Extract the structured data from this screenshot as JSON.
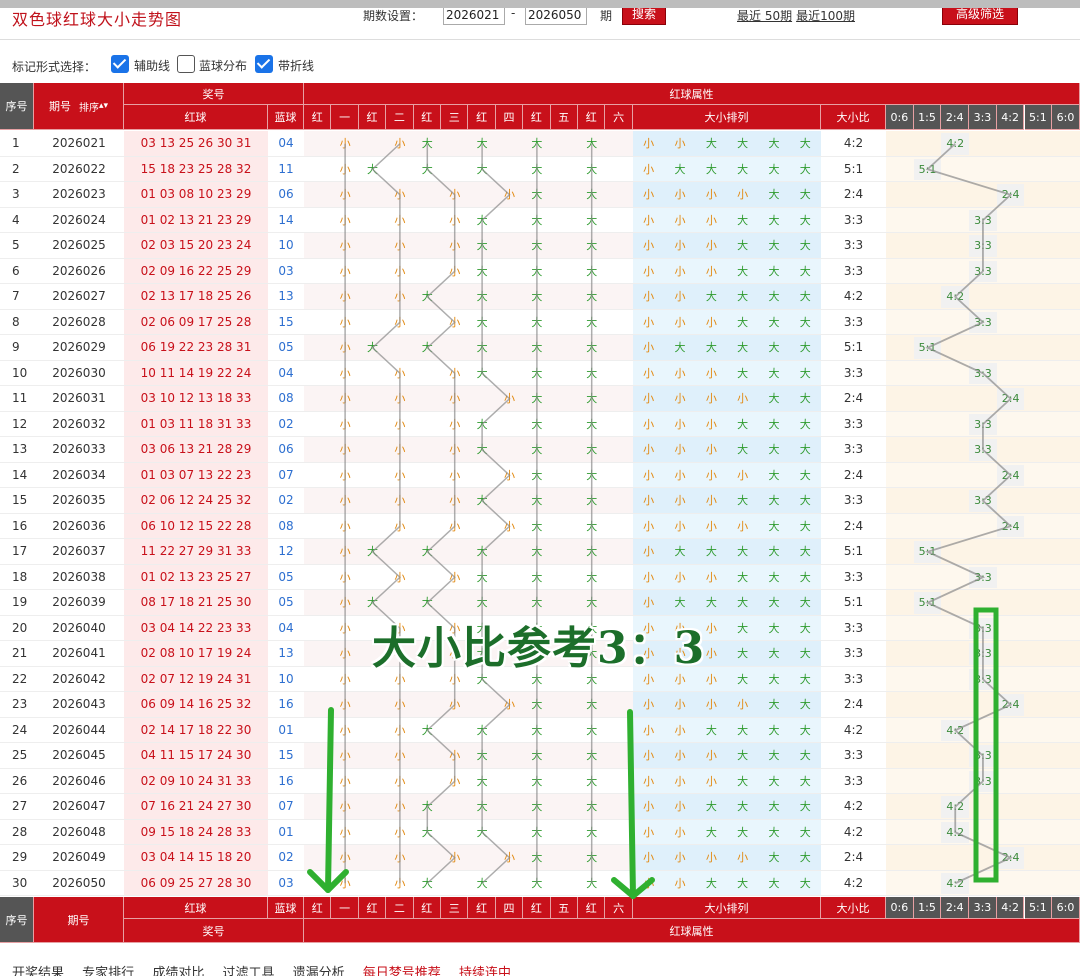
{
  "header": {
    "title": "双色球红球大小走势图",
    "period_label": "期数设置：",
    "period_from": "2026021",
    "period_to": "2026050",
    "period_dash": "-",
    "period_unit": "期",
    "search_label": "搜索",
    "recent_50": "最近 50期",
    "recent_100": "最近100期",
    "advanced_label": "高级筛选"
  },
  "options": {
    "label": "标记形式选择：",
    "items": [
      {
        "label": "辅助线",
        "checked": true
      },
      {
        "label": "蓝球分布",
        "checked": false
      },
      {
        "label": "带折线",
        "checked": true
      }
    ]
  },
  "table": {
    "h_index": "序号",
    "h_period": "期号",
    "h_sort": "排序",
    "h_prize": "奖号",
    "h_red": "红球",
    "h_blue": "蓝球",
    "h_attr": "红球属性",
    "h_size_seq": "大小排列",
    "h_ratio": "大小比",
    "pos_headers": [
      "红",
      "一",
      "红",
      "二",
      "红",
      "三",
      "红",
      "四",
      "红",
      "五",
      "红",
      "六"
    ],
    "ratio_headers": [
      "0:6",
      "1:5",
      "2:4",
      "3:3",
      "4:2",
      "5:1",
      "6:0"
    ],
    "small": "小",
    "big": "大",
    "rows": [
      {
        "idx": "1",
        "period": "2026021",
        "red": "03 13 25 26 30 31",
        "blue": "04",
        "seq": "小小大大大大",
        "ratio": "4:2"
      },
      {
        "idx": "2",
        "period": "2026022",
        "red": "15 18 23 25 28 32",
        "blue": "11",
        "seq": "小大大大大大",
        "ratio": "5:1"
      },
      {
        "idx": "3",
        "period": "2026023",
        "red": "01 03 08 10 23 29",
        "blue": "06",
        "seq": "小小小小大大",
        "ratio": "2:4"
      },
      {
        "idx": "4",
        "period": "2026024",
        "red": "01 02 13 21 23 29",
        "blue": "14",
        "seq": "小小小大大大",
        "ratio": "3:3"
      },
      {
        "idx": "5",
        "period": "2026025",
        "red": "02 03 15 20 23 24",
        "blue": "10",
        "seq": "小小小大大大",
        "ratio": "3:3"
      },
      {
        "idx": "6",
        "period": "2026026",
        "red": "02 09 16 22 25 29",
        "blue": "03",
        "seq": "小小小大大大",
        "ratio": "3:3"
      },
      {
        "idx": "7",
        "period": "2026027",
        "red": "02 13 17 18 25 26",
        "blue": "13",
        "seq": "小小大大大大",
        "ratio": "4:2"
      },
      {
        "idx": "8",
        "period": "2026028",
        "red": "02 06 09 17 25 28",
        "blue": "15",
        "seq": "小小小大大大",
        "ratio": "3:3"
      },
      {
        "idx": "9",
        "period": "2026029",
        "red": "06 19 22 23 28 31",
        "blue": "05",
        "seq": "小大大大大大",
        "ratio": "5:1"
      },
      {
        "idx": "10",
        "period": "2026030",
        "red": "10 11 14 19 22 24",
        "blue": "04",
        "seq": "小小小大大大",
        "ratio": "3:3"
      },
      {
        "idx": "11",
        "period": "2026031",
        "red": "03 10 12 13 18 33",
        "blue": "08",
        "seq": "小小小小大大",
        "ratio": "2:4"
      },
      {
        "idx": "12",
        "period": "2026032",
        "red": "01 03 11 18 31 33",
        "blue": "02",
        "seq": "小小小大大大",
        "ratio": "3:3"
      },
      {
        "idx": "13",
        "period": "2026033",
        "red": "03 06 13 21 28 29",
        "blue": "06",
        "seq": "小小小大大大",
        "ratio": "3:3"
      },
      {
        "idx": "14",
        "period": "2026034",
        "red": "01 03 07 13 22 23",
        "blue": "07",
        "seq": "小小小小大大",
        "ratio": "2:4"
      },
      {
        "idx": "15",
        "period": "2026035",
        "red": "02 06 12 24 25 32",
        "blue": "02",
        "seq": "小小小大大大",
        "ratio": "3:3"
      },
      {
        "idx": "16",
        "period": "2026036",
        "red": "06 10 12 15 22 28",
        "blue": "08",
        "seq": "小小小小大大",
        "ratio": "2:4"
      },
      {
        "idx": "17",
        "period": "2026037",
        "red": "11 22 27 29 31 33",
        "blue": "12",
        "seq": "小大大大大大",
        "ratio": "5:1"
      },
      {
        "idx": "18",
        "period": "2026038",
        "red": "01 02 13 23 25 27",
        "blue": "05",
        "seq": "小小小大大大",
        "ratio": "3:3"
      },
      {
        "idx": "19",
        "period": "2026039",
        "red": "08 17 18 21 25 30",
        "blue": "05",
        "seq": "小大大大大大",
        "ratio": "5:1"
      },
      {
        "idx": "20",
        "period": "2026040",
        "red": "03 04 14 22 23 33",
        "blue": "04",
        "seq": "小小小大大大",
        "ratio": "3:3"
      },
      {
        "idx": "21",
        "period": "2026041",
        "red": "02 08 10 17 19 24",
        "blue": "13",
        "seq": "小小小大大大",
        "ratio": "3:3"
      },
      {
        "idx": "22",
        "period": "2026042",
        "red": "02 07 12 19 24 31",
        "blue": "10",
        "seq": "小小小大大大",
        "ratio": "3:3"
      },
      {
        "idx": "23",
        "period": "2026043",
        "red": "06 09 14 16 25 32",
        "blue": "16",
        "seq": "小小小小大大",
        "ratio": "2:4"
      },
      {
        "idx": "24",
        "period": "2026044",
        "red": "02 14 17 18 22 30",
        "blue": "01",
        "seq": "小小大大大大",
        "ratio": "4:2"
      },
      {
        "idx": "25",
        "period": "2026045",
        "red": "04 11 15 17 24 30",
        "blue": "15",
        "seq": "小小小大大大",
        "ratio": "3:3"
      },
      {
        "idx": "26",
        "period": "2026046",
        "red": "02 09 10 24 31 33",
        "blue": "16",
        "seq": "小小小大大大",
        "ratio": "3:3"
      },
      {
        "idx": "27",
        "period": "2026047",
        "red": "07 16 21 24 27 30",
        "blue": "07",
        "seq": "小小大大大大",
        "ratio": "4:2"
      },
      {
        "idx": "28",
        "period": "2026048",
        "red": "09 15 18 24 28 33",
        "blue": "01",
        "seq": "小小大大大大",
        "ratio": "4:2"
      },
      {
        "idx": "29",
        "period": "2026049",
        "red": "03 04 14 15 18 20",
        "blue": "02",
        "seq": "小小小小大大",
        "ratio": "2:4"
      },
      {
        "idx": "30",
        "period": "2026050",
        "red": "06 09 25 27 28 30",
        "blue": "03",
        "seq": "小小大大大大",
        "ratio": "4:2"
      }
    ]
  },
  "annotation": {
    "text": "大小比参考3：3",
    "color": "#1c6e2a",
    "box_color": "#2fb030"
  },
  "bottom_nav": [
    "开奖结果",
    "专家排行",
    "成绩对比",
    "过滤工具",
    "遗漏分析",
    "每日梦号推荐",
    "持续连中"
  ],
  "colors": {
    "brand_red": "#c8101a",
    "blue_ball": "#2d6fd0",
    "red_ball": "#c8101a",
    "big": "#2f9b2f",
    "small": "#e28a12"
  }
}
